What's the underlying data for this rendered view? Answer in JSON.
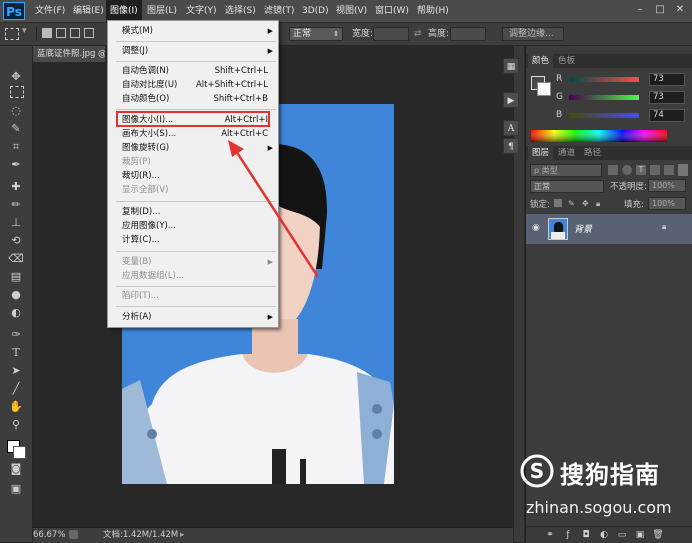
{
  "app": {
    "logo": "Ps"
  },
  "menubar": {
    "items": [
      "文件(F)",
      "编辑(E)",
      "图像(I)",
      "图层(L)",
      "文字(Y)",
      "选择(S)",
      "滤镜(T)",
      "3D(D)",
      "视图(V)",
      "窗口(W)",
      "帮助(H)"
    ],
    "active_index": 2
  },
  "window_controls": {
    "minimize": "–",
    "maximize": "□",
    "close": "✕"
  },
  "options_bar": {
    "mode_value": "正常",
    "width_label": "宽度:",
    "height_label": "高度:",
    "adjust_edge": "调整边缘..."
  },
  "document": {
    "tab_title": "蓝底证件照.jpg @",
    "zoom": "66.67%",
    "doc_info": "文档:1.42M/1.42M"
  },
  "image_menu": {
    "items": [
      {
        "label": "模式(M)",
        "shortcut": "",
        "submenu": true,
        "disabled": false
      },
      {
        "label": "调整(J)",
        "shortcut": "",
        "submenu": true,
        "disabled": false
      },
      {
        "label": "自动色调(N)",
        "shortcut": "Shift+Ctrl+L",
        "submenu": false,
        "disabled": false
      },
      {
        "label": "自动对比度(U)",
        "shortcut": "Alt+Shift+Ctrl+L",
        "submenu": false,
        "disabled": false
      },
      {
        "label": "自动颜色(O)",
        "shortcut": "Shift+Ctrl+B",
        "submenu": false,
        "disabled": false
      },
      {
        "label": "图像大小(I)...",
        "shortcut": "Alt+Ctrl+I",
        "submenu": false,
        "disabled": false
      },
      {
        "label": "画布大小(S)...",
        "shortcut": "Alt+Ctrl+C",
        "submenu": false,
        "disabled": false
      },
      {
        "label": "图像旋转(G)",
        "shortcut": "",
        "submenu": true,
        "disabled": false
      },
      {
        "label": "裁剪(P)",
        "shortcut": "",
        "submenu": false,
        "disabled": true
      },
      {
        "label": "裁切(R)...",
        "shortcut": "",
        "submenu": false,
        "disabled": false
      },
      {
        "label": "显示全部(V)",
        "shortcut": "",
        "submenu": false,
        "disabled": true
      },
      {
        "label": "复制(D)...",
        "shortcut": "",
        "submenu": false,
        "disabled": false
      },
      {
        "label": "应用图像(Y)...",
        "shortcut": "",
        "submenu": false,
        "disabled": false
      },
      {
        "label": "计算(C)...",
        "shortcut": "",
        "submenu": false,
        "disabled": false
      },
      {
        "label": "变量(B)",
        "shortcut": "",
        "submenu": true,
        "disabled": true
      },
      {
        "label": "应用数据组(L)...",
        "shortcut": "",
        "submenu": false,
        "disabled": true
      },
      {
        "label": "陷印(T)...",
        "shortcut": "",
        "submenu": false,
        "disabled": true
      },
      {
        "label": "分析(A)",
        "shortcut": "",
        "submenu": true,
        "disabled": false
      }
    ],
    "highlighted_item": "图像大小(I)...",
    "highlight_color": "#e3322f"
  },
  "color_panel": {
    "tabs": [
      "颜色",
      "色板"
    ],
    "channels": [
      {
        "label": "R",
        "value": "73"
      },
      {
        "label": "G",
        "value": "73"
      },
      {
        "label": "B",
        "value": "74"
      }
    ]
  },
  "layers_panel": {
    "tabs": [
      "图层",
      "通道",
      "路径"
    ],
    "filter_label": "ρ 类型",
    "blend_mode": "正常",
    "opacity_label": "不透明度:",
    "opacity_value": "100%",
    "lock_label": "锁定:",
    "fill_label": "填充:",
    "fill_value": "100%",
    "layer_name": "背景"
  },
  "watermark": {
    "brand": "搜狗指南",
    "url": "zhinan.sogou.com",
    "logo_letter": "S"
  },
  "colors": {
    "canvas_blue": "#3f86da",
    "menu_bg": "#f0f0f0",
    "accent_red": "#e3322f"
  }
}
